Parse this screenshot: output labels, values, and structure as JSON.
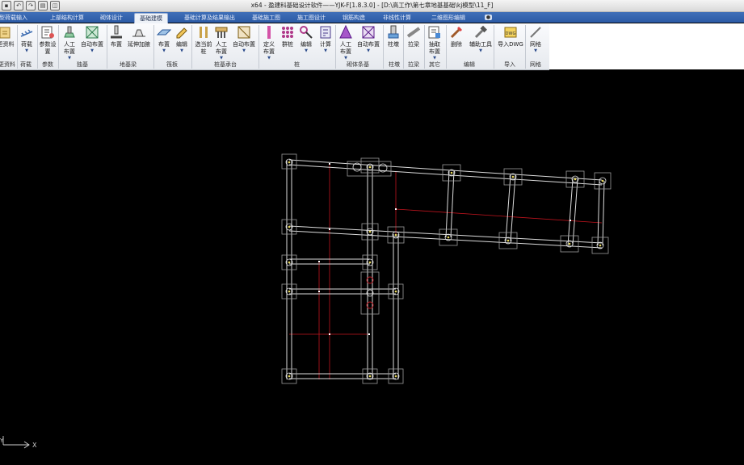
{
  "window": {
    "title": "x64 - 盈建科基础设计软件——YJK-F[1.8.3.0] - [D:\\高工作\\第七章地基基础\\kj模型\\11_F]"
  },
  "tabs": [
    {
      "label": "模型荷载输入"
    },
    {
      "label": "上部结构计算"
    },
    {
      "label": "砌体设计"
    },
    {
      "label": "基础建模"
    },
    {
      "label": "基础计算及结果输出"
    },
    {
      "label": "基础施工图"
    },
    {
      "label": "施工图设计"
    },
    {
      "label": "钢筋构造"
    },
    {
      "label": "非线性计算"
    },
    {
      "label": "二维图形编辑"
    }
  ],
  "ribbon": {
    "buttons": [
      {
        "label": "更资料",
        "icon": "import-icon"
      },
      {
        "label": "荷载",
        "icon": "load-icon"
      },
      {
        "label": "参数设置",
        "icon": "settings-icon"
      },
      {
        "label": "人工布置",
        "icon": "manual-place-icon"
      },
      {
        "label": "自动布置",
        "icon": "auto-place-icon"
      },
      {
        "label": "布置",
        "icon": "place-icon"
      },
      {
        "label": "延伸加腋",
        "icon": "haunch-icon"
      },
      {
        "label": "布置",
        "icon": "slab-place-icon"
      },
      {
        "label": "编辑",
        "icon": "edit-icon"
      },
      {
        "label": "选当前桩",
        "icon": "pile-select-icon"
      },
      {
        "label": "人工布置",
        "icon": "cap-place-icon"
      },
      {
        "label": "自动布置",
        "icon": "cap-auto-icon"
      },
      {
        "label": "定义布置",
        "icon": "pile-define-icon"
      },
      {
        "label": "群桩",
        "icon": "pile-group-icon"
      },
      {
        "label": "编辑",
        "icon": "pile-edit-icon"
      },
      {
        "label": "计算",
        "icon": "calculate-icon"
      },
      {
        "label": "人工布置",
        "icon": "masonry-place-icon"
      },
      {
        "label": "自动布置",
        "icon": "masonry-auto-icon"
      },
      {
        "label": "柱墩",
        "icon": "column-pier-icon"
      },
      {
        "label": "拉梁",
        "icon": "tie-beam-icon"
      },
      {
        "label": "抽取布置",
        "icon": "extract-icon"
      },
      {
        "label": "删除",
        "icon": "delete-icon"
      },
      {
        "label": "辅助工具",
        "icon": "tools-icon"
      },
      {
        "label": "导入DWG",
        "icon": "dwg-icon"
      },
      {
        "label": "网格",
        "icon": "grid-icon"
      }
    ],
    "groups": [
      "更资料",
      "荷载",
      "参数",
      "独基",
      "地基梁",
      "筏板",
      "桩基承台",
      "桩",
      "砌体条基",
      "柱墩",
      "拉梁",
      "其它",
      "编辑",
      "导入",
      "网格"
    ]
  },
  "canvas": {
    "background": "#000000",
    "axis_labels": {
      "x": "X",
      "y": "Y"
    }
  },
  "colors": {
    "tab_bar": "#2b5aa5",
    "beam": "#e8e8e8",
    "red_axis": "#c0141e",
    "pile_box": "#9a9a9a"
  }
}
